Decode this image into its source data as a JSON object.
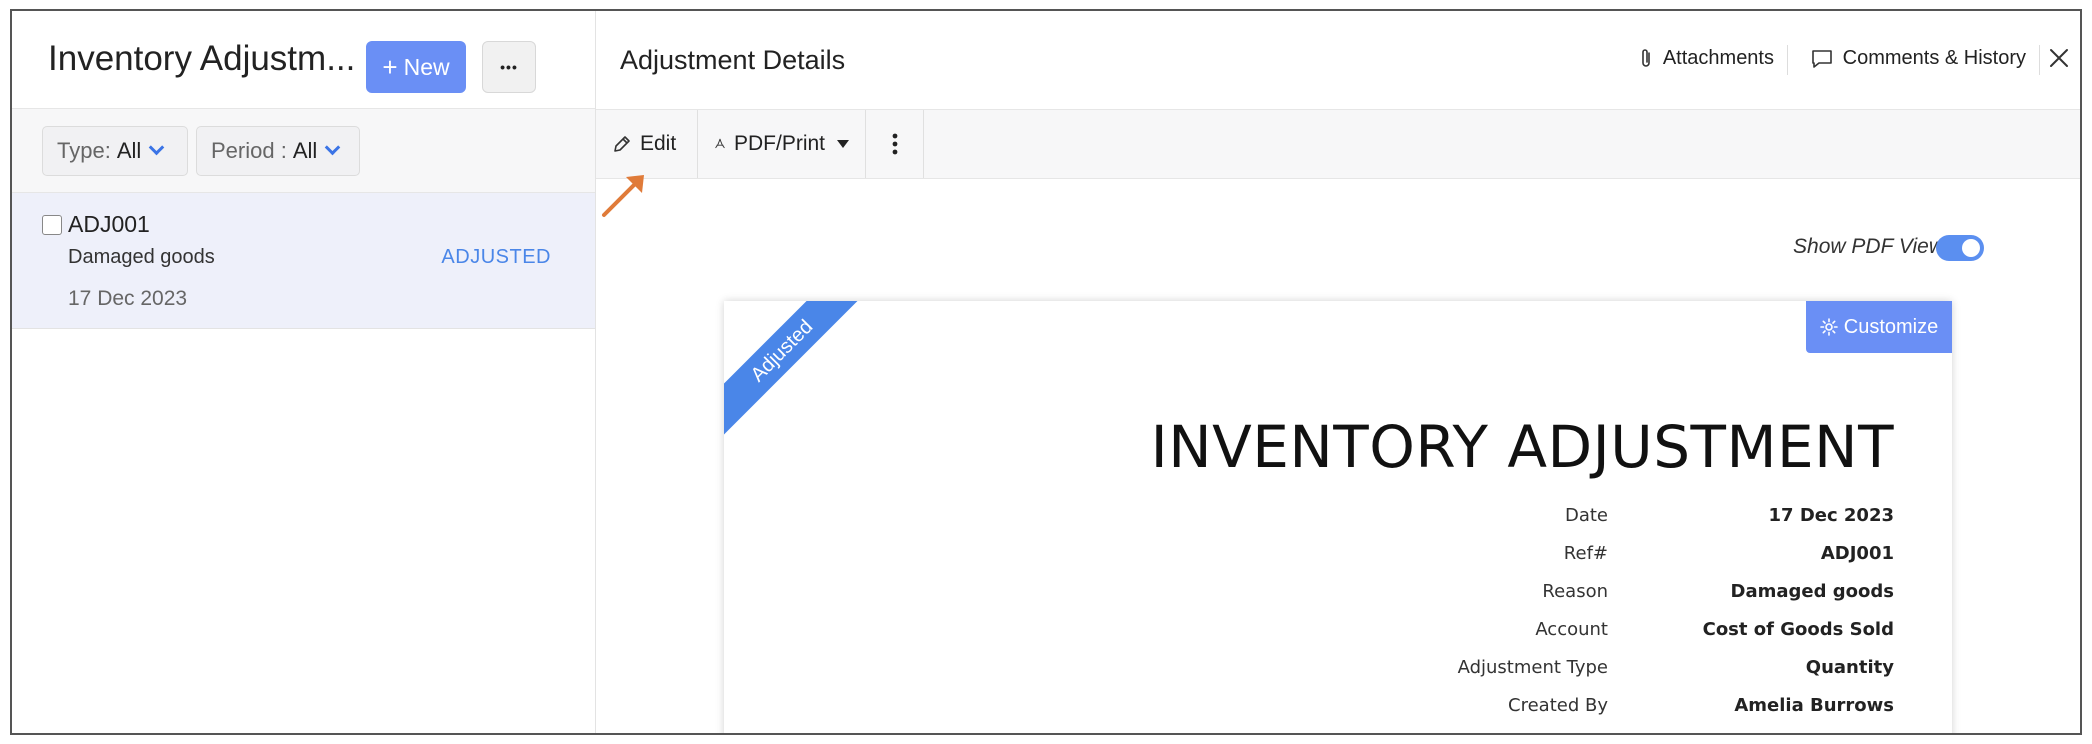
{
  "left": {
    "title": "Inventory Adjustm...",
    "new_label": "New",
    "more_label": "•••",
    "filters": {
      "type_label": "Type:",
      "type_value": "All",
      "period_label": "Period :",
      "period_value": "All"
    },
    "items": [
      {
        "id": "ADJ001",
        "reason": "Damaged goods",
        "status": "ADJUSTED",
        "date": "17 Dec 2023"
      }
    ]
  },
  "right": {
    "title": "Adjustment Details",
    "attachments_label": "Attachments",
    "comments_label": "Comments & History",
    "toolbar": {
      "edit_label": "Edit",
      "pdf_label": "PDF/Print"
    },
    "show_pdf_label": "Show PDF View",
    "show_pdf_on": true
  },
  "document": {
    "ribbon": "Adjusted",
    "customize_label": "Customize",
    "title": "INVENTORY ADJUSTMENT",
    "fields": [
      {
        "key": "Date",
        "value": "17 Dec 2023"
      },
      {
        "key": "Ref#",
        "value": "ADJ001"
      },
      {
        "key": "Reason",
        "value": "Damaged goods"
      },
      {
        "key": "Account",
        "value": "Cost of Goods Sold"
      },
      {
        "key": "Adjustment Type",
        "value": "Quantity"
      },
      {
        "key": "Created By",
        "value": "Amelia Burrows"
      }
    ]
  },
  "colors": {
    "accent": "#6a8ff5",
    "status_blue": "#4a86e8",
    "selected_row": "#eef0fa",
    "arrow": "#e07b39"
  }
}
